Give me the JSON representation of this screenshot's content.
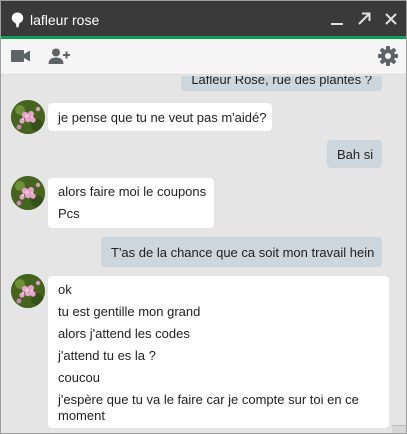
{
  "window": {
    "title": "lafleur rose"
  },
  "icons": {
    "title": "map-pin-icon",
    "minimize": "minimize-icon",
    "popout": "popout-arrow-icon",
    "close": "close-icon",
    "video": "video-camera-icon",
    "add_person": "add-person-icon",
    "settings": "gear-icon",
    "avatar": "flower-avatar"
  },
  "colors": {
    "titlebar": "#3a3a3a",
    "accent_green": "#0f9d58",
    "chat_background": "#e5e5e5",
    "outgoing_bubble": "#cdd6dd",
    "incoming_bubble": "#ffffff"
  },
  "messages": [
    {
      "direction": "outgoing",
      "lines": [
        "Lafleur Rose, rue des plantes ?"
      ]
    },
    {
      "direction": "incoming",
      "lines": [
        "je pense que tu ne veut pas m'aidé?"
      ]
    },
    {
      "direction": "outgoing",
      "lines": [
        "Bah si"
      ]
    },
    {
      "direction": "incoming",
      "lines": [
        "alors faire moi le coupons",
        "Pcs"
      ]
    },
    {
      "direction": "outgoing",
      "lines": [
        "T'as de la chance que ca soit mon travail hein"
      ]
    },
    {
      "direction": "incoming",
      "lines": [
        "ok",
        "tu est gentille mon grand",
        "alors j'attend les codes",
        "j'attend tu es la ?",
        "coucou",
        "j'espère que tu va le  faire car je compte sur toi en ce",
        "moment"
      ]
    }
  ]
}
